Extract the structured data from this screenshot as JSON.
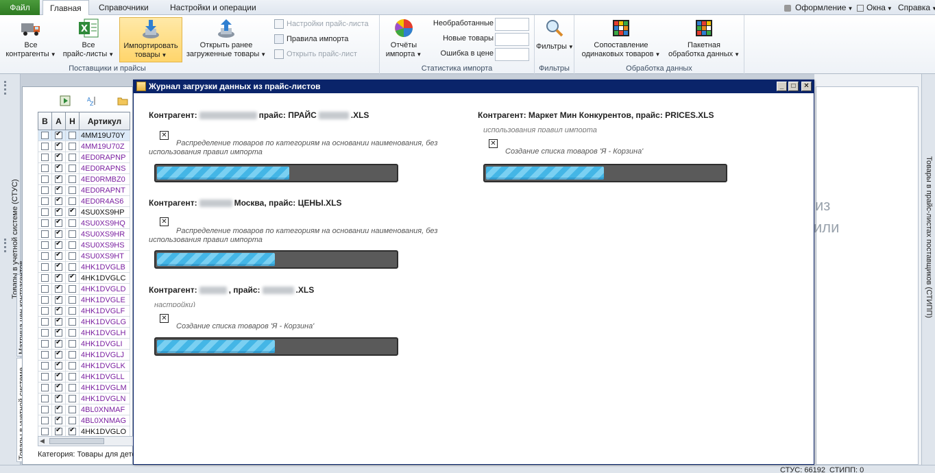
{
  "ribbon_tabs": {
    "file": "Файл",
    "home": "Главная",
    "refs": "Справочники",
    "settings": "Настройки и операции"
  },
  "top_right": {
    "design": "Оформление",
    "windows": "Окна",
    "help": "Справка"
  },
  "groups": {
    "suppliers": {
      "label": "Поставщики и прайсы",
      "all_contractors_1": "Все",
      "all_contractors_2": "контрагенты",
      "all_prices_1": "Все",
      "all_prices_2": "прайс-листы",
      "import_1": "Импортировать",
      "import_2": "товары",
      "open_prev_1": "Открыть ранее",
      "open_prev_2": "загруженные товары",
      "price_settings": "Настройки прайс-листа",
      "import_rules": "Правила импорта",
      "open_price": "Открыть прайс-лист"
    },
    "stats": {
      "label": "Статистика импорта",
      "reports_1": "Отчёты",
      "reports_2": "импорта",
      "unprocessed": "Необработанные",
      "new_goods": "Новые товары",
      "price_error": "Ошибка в цене"
    },
    "filters": {
      "label": "Фильтры",
      "btn": "Фильтры"
    },
    "processing": {
      "label": "Обработка данных",
      "match_1": "Сопоставление",
      "match_2": "одинаковых товаров",
      "batch_1": "Пакетная",
      "batch_2": "обработка данных"
    }
  },
  "left_strip": {
    "outer": "Товары в учетной системе (СТУС)",
    "tab_matrix": "Матрица цен контрагентов",
    "tab_goods": "Товары в учетной системе"
  },
  "grid": {
    "headers": [
      "В",
      "А",
      "Н",
      "Артикул"
    ],
    "rows": [
      {
        "b": false,
        "a": true,
        "n": false,
        "art": "4MM19U70Y",
        "plain": true,
        "sel": true
      },
      {
        "b": false,
        "a": true,
        "n": false,
        "art": "4MM19U70Z",
        "plain": false
      },
      {
        "b": false,
        "a": true,
        "n": false,
        "art": "4ED0RAPNP",
        "plain": false
      },
      {
        "b": false,
        "a": true,
        "n": false,
        "art": "4ED0RAPNS",
        "plain": false
      },
      {
        "b": false,
        "a": true,
        "n": false,
        "art": "4ED0RMBZ0",
        "plain": false
      },
      {
        "b": false,
        "a": true,
        "n": false,
        "art": "4ED0RAPNT",
        "plain": false
      },
      {
        "b": false,
        "a": true,
        "n": false,
        "art": "4ED0R4AS6",
        "plain": false
      },
      {
        "b": false,
        "a": true,
        "n": true,
        "art": "4SU0XS9HP",
        "plain": true
      },
      {
        "b": false,
        "a": true,
        "n": false,
        "art": "4SU0XS9HQ",
        "plain": false
      },
      {
        "b": false,
        "a": true,
        "n": false,
        "art": "4SU0XS9HR",
        "plain": false
      },
      {
        "b": false,
        "a": true,
        "n": false,
        "art": "4SU0XS9HS",
        "plain": false
      },
      {
        "b": false,
        "a": true,
        "n": false,
        "art": "4SU0XS9HT",
        "plain": false
      },
      {
        "b": false,
        "a": true,
        "n": false,
        "art": "4HK1DVGLB",
        "plain": false
      },
      {
        "b": false,
        "a": true,
        "n": true,
        "art": "4HK1DVGLC",
        "plain": true
      },
      {
        "b": false,
        "a": true,
        "n": false,
        "art": "4HK1DVGLD",
        "plain": false
      },
      {
        "b": false,
        "a": true,
        "n": false,
        "art": "4HK1DVGLE",
        "plain": false
      },
      {
        "b": false,
        "a": true,
        "n": false,
        "art": "4HK1DVGLF",
        "plain": false
      },
      {
        "b": false,
        "a": true,
        "n": false,
        "art": "4HK1DVGLG",
        "plain": false
      },
      {
        "b": false,
        "a": true,
        "n": false,
        "art": "4HK1DVGLH",
        "plain": false
      },
      {
        "b": false,
        "a": true,
        "n": false,
        "art": "4HK1DVGLI",
        "plain": false
      },
      {
        "b": false,
        "a": true,
        "n": false,
        "art": "4HK1DVGLJ",
        "plain": false
      },
      {
        "b": false,
        "a": true,
        "n": false,
        "art": "4HK1DVGLK",
        "plain": false
      },
      {
        "b": false,
        "a": true,
        "n": false,
        "art": "4HK1DVGLL",
        "plain": false
      },
      {
        "b": false,
        "a": true,
        "n": false,
        "art": "4HK1DVGLM",
        "plain": false
      },
      {
        "b": false,
        "a": true,
        "n": false,
        "art": "4HK1DVGLN",
        "plain": false
      },
      {
        "b": false,
        "a": true,
        "n": false,
        "art": "4BL0XNMAF",
        "plain": false
      },
      {
        "b": false,
        "a": true,
        "n": false,
        "art": "4BL0XNMAG",
        "plain": false
      },
      {
        "b": false,
        "a": true,
        "n": true,
        "art": "4HK1DVGLO",
        "plain": true
      }
    ],
    "category": "Категория: Товары для детей /"
  },
  "right": {
    "fragment_1": "из",
    "fragment_2": "или",
    "strip": "Товары в прайс-листах поставщиков (СТИПП)"
  },
  "statusbar": {
    "stus": "СТУС: 66192",
    "stipp": "СТИПП: 0"
  },
  "dialog": {
    "title": "Журнал загрузки данных из прайс-листов",
    "jobs": [
      {
        "prefix": "Контрагент:",
        "mid": "прайс: ПРАЙС",
        "suffix": ".XLS",
        "cut": "",
        "message": "Распределение товаров по категориям на основании наименования, без использования правил импорта",
        "progress": 0.56
      },
      {
        "prefix": "Контрагент:",
        "mid": "Москва, прайс: ЦЕНЫ.XLS",
        "suffix": "",
        "cut": "",
        "message": "Распределение товаров по категориям на основании наименования, без использования правил импорта",
        "progress": 0.5
      },
      {
        "prefix": "Контрагент:",
        "mid": ", прайс:",
        "suffix": ".XLS",
        "cut": "настройки)",
        "message": "Создание списка товаров 'Я - Корзина'",
        "progress": 0.5
      },
      {
        "prefix": "Контрагент: Маркет Мин Конкурентов, прайс: PRICES.XLS",
        "mid": "",
        "suffix": "",
        "cut": "использования правил импорта",
        "message": "Создание списка товаров 'Я - Корзина'",
        "progress": 0.5
      }
    ]
  }
}
